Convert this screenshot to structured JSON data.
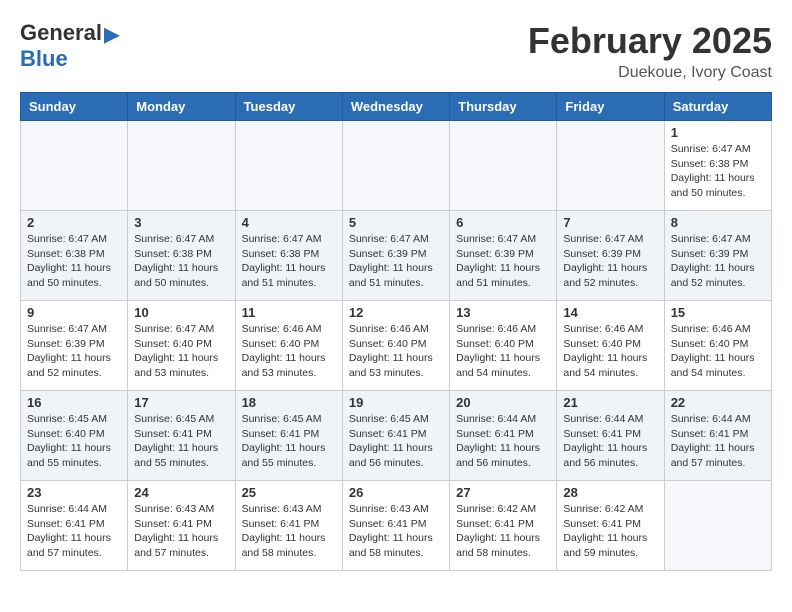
{
  "header": {
    "logo_general": "General",
    "logo_blue": "Blue",
    "month_title": "February 2025",
    "location": "Duekoue, Ivory Coast"
  },
  "days_of_week": [
    "Sunday",
    "Monday",
    "Tuesday",
    "Wednesday",
    "Thursday",
    "Friday",
    "Saturday"
  ],
  "weeks": [
    {
      "days": [
        {
          "number": "",
          "info": ""
        },
        {
          "number": "",
          "info": ""
        },
        {
          "number": "",
          "info": ""
        },
        {
          "number": "",
          "info": ""
        },
        {
          "number": "",
          "info": ""
        },
        {
          "number": "",
          "info": ""
        },
        {
          "number": "1",
          "info": "Sunrise: 6:47 AM\nSunset: 6:38 PM\nDaylight: 11 hours\nand 50 minutes."
        }
      ]
    },
    {
      "days": [
        {
          "number": "2",
          "info": "Sunrise: 6:47 AM\nSunset: 6:38 PM\nDaylight: 11 hours\nand 50 minutes."
        },
        {
          "number": "3",
          "info": "Sunrise: 6:47 AM\nSunset: 6:38 PM\nDaylight: 11 hours\nand 50 minutes."
        },
        {
          "number": "4",
          "info": "Sunrise: 6:47 AM\nSunset: 6:38 PM\nDaylight: 11 hours\nand 51 minutes."
        },
        {
          "number": "5",
          "info": "Sunrise: 6:47 AM\nSunset: 6:39 PM\nDaylight: 11 hours\nand 51 minutes."
        },
        {
          "number": "6",
          "info": "Sunrise: 6:47 AM\nSunset: 6:39 PM\nDaylight: 11 hours\nand 51 minutes."
        },
        {
          "number": "7",
          "info": "Sunrise: 6:47 AM\nSunset: 6:39 PM\nDaylight: 11 hours\nand 52 minutes."
        },
        {
          "number": "8",
          "info": "Sunrise: 6:47 AM\nSunset: 6:39 PM\nDaylight: 11 hours\nand 52 minutes."
        }
      ]
    },
    {
      "days": [
        {
          "number": "9",
          "info": "Sunrise: 6:47 AM\nSunset: 6:39 PM\nDaylight: 11 hours\nand 52 minutes."
        },
        {
          "number": "10",
          "info": "Sunrise: 6:47 AM\nSunset: 6:40 PM\nDaylight: 11 hours\nand 53 minutes."
        },
        {
          "number": "11",
          "info": "Sunrise: 6:46 AM\nSunset: 6:40 PM\nDaylight: 11 hours\nand 53 minutes."
        },
        {
          "number": "12",
          "info": "Sunrise: 6:46 AM\nSunset: 6:40 PM\nDaylight: 11 hours\nand 53 minutes."
        },
        {
          "number": "13",
          "info": "Sunrise: 6:46 AM\nSunset: 6:40 PM\nDaylight: 11 hours\nand 54 minutes."
        },
        {
          "number": "14",
          "info": "Sunrise: 6:46 AM\nSunset: 6:40 PM\nDaylight: 11 hours\nand 54 minutes."
        },
        {
          "number": "15",
          "info": "Sunrise: 6:46 AM\nSunset: 6:40 PM\nDaylight: 11 hours\nand 54 minutes."
        }
      ]
    },
    {
      "days": [
        {
          "number": "16",
          "info": "Sunrise: 6:45 AM\nSunset: 6:40 PM\nDaylight: 11 hours\nand 55 minutes."
        },
        {
          "number": "17",
          "info": "Sunrise: 6:45 AM\nSunset: 6:41 PM\nDaylight: 11 hours\nand 55 minutes."
        },
        {
          "number": "18",
          "info": "Sunrise: 6:45 AM\nSunset: 6:41 PM\nDaylight: 11 hours\nand 55 minutes."
        },
        {
          "number": "19",
          "info": "Sunrise: 6:45 AM\nSunset: 6:41 PM\nDaylight: 11 hours\nand 56 minutes."
        },
        {
          "number": "20",
          "info": "Sunrise: 6:44 AM\nSunset: 6:41 PM\nDaylight: 11 hours\nand 56 minutes."
        },
        {
          "number": "21",
          "info": "Sunrise: 6:44 AM\nSunset: 6:41 PM\nDaylight: 11 hours\nand 56 minutes."
        },
        {
          "number": "22",
          "info": "Sunrise: 6:44 AM\nSunset: 6:41 PM\nDaylight: 11 hours\nand 57 minutes."
        }
      ]
    },
    {
      "days": [
        {
          "number": "23",
          "info": "Sunrise: 6:44 AM\nSunset: 6:41 PM\nDaylight: 11 hours\nand 57 minutes."
        },
        {
          "number": "24",
          "info": "Sunrise: 6:43 AM\nSunset: 6:41 PM\nDaylight: 11 hours\nand 57 minutes."
        },
        {
          "number": "25",
          "info": "Sunrise: 6:43 AM\nSunset: 6:41 PM\nDaylight: 11 hours\nand 58 minutes."
        },
        {
          "number": "26",
          "info": "Sunrise: 6:43 AM\nSunset: 6:41 PM\nDaylight: 11 hours\nand 58 minutes."
        },
        {
          "number": "27",
          "info": "Sunrise: 6:42 AM\nSunset: 6:41 PM\nDaylight: 11 hours\nand 58 minutes."
        },
        {
          "number": "28",
          "info": "Sunrise: 6:42 AM\nSunset: 6:41 PM\nDaylight: 11 hours\nand 59 minutes."
        },
        {
          "number": "",
          "info": ""
        }
      ]
    }
  ]
}
